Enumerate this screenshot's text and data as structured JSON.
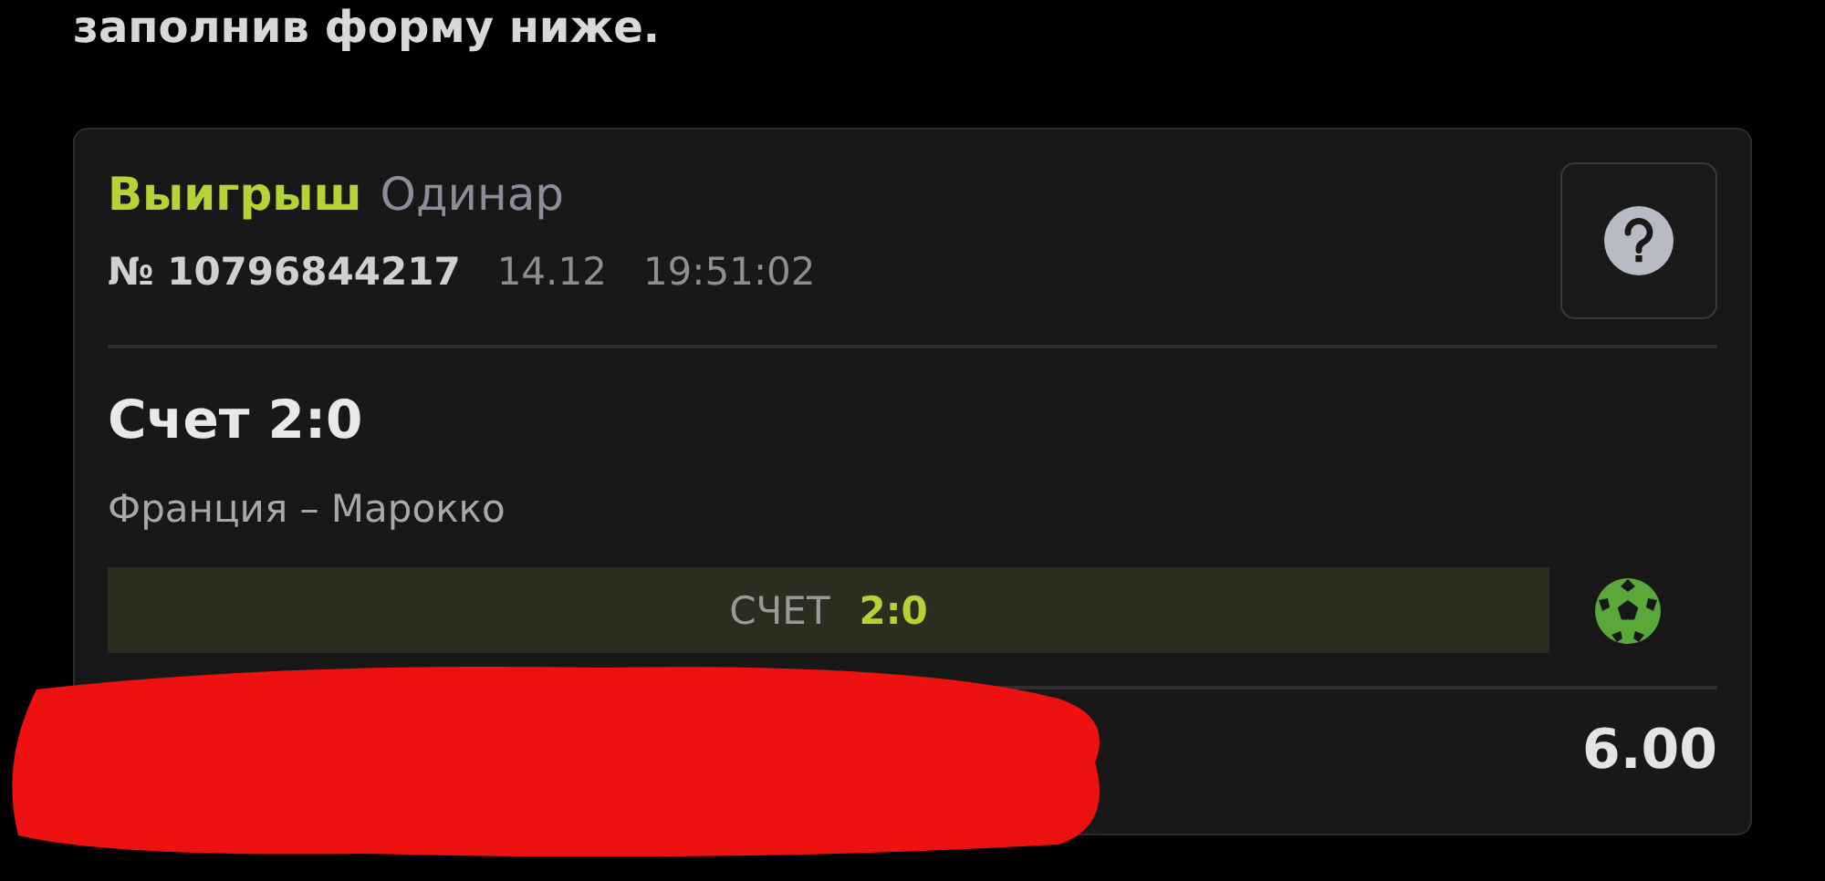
{
  "intro_text": "заполнив форму ниже.",
  "bet": {
    "status": "Выигрыш",
    "type": "Одинар",
    "number": "№ 10796844217",
    "date": "14.12",
    "time": "19:51:02",
    "market": "Счет 2:0",
    "event": "Франция – Марокко",
    "result": {
      "label": "СЧЕТ",
      "value": "2:0"
    },
    "odds": "6.00"
  }
}
